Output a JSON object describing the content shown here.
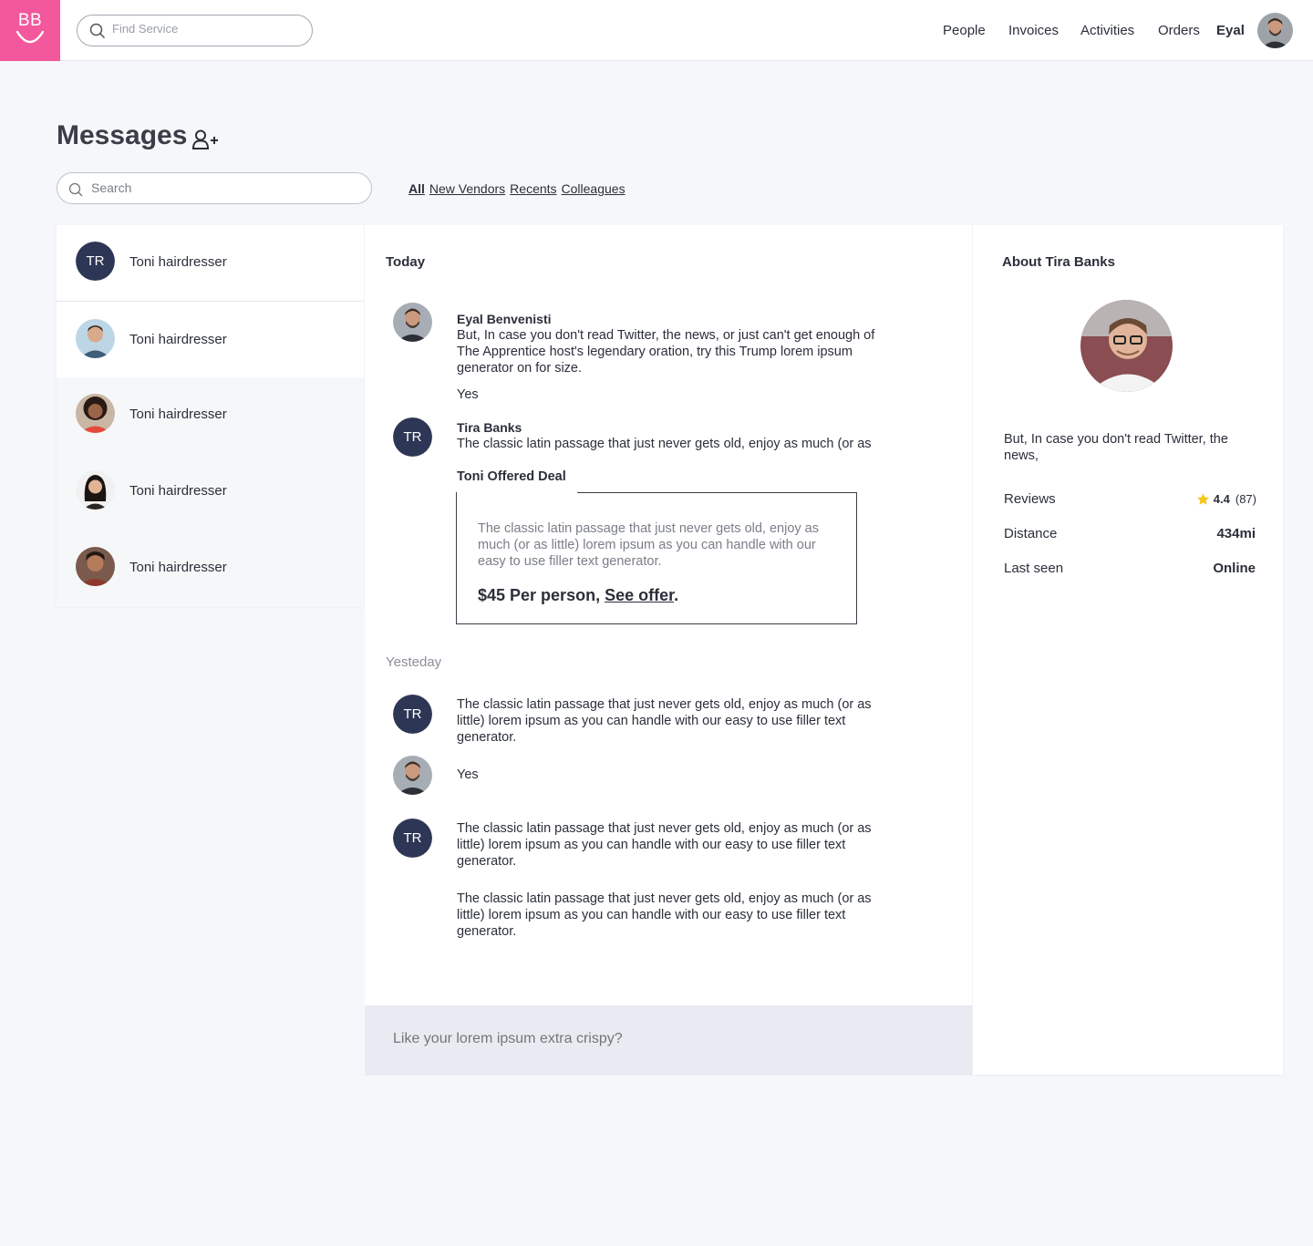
{
  "header": {
    "logo_text": "BB",
    "find_placeholder": "Find Service",
    "nav": [
      "People",
      "Invoices",
      "Activities",
      "Orders"
    ],
    "user_name": "Eyal"
  },
  "page": {
    "title": "Messages",
    "search_placeholder": "Search",
    "filters": [
      "All",
      "New Vendors",
      "Recents",
      "Colleagues"
    ]
  },
  "contacts": [
    {
      "name": "Toni hairdresser",
      "initials": "TR"
    },
    {
      "name": "Toni hairdresser"
    },
    {
      "name": "Toni hairdresser"
    },
    {
      "name": "Toni hairdresser"
    },
    {
      "name": "Toni hairdresser"
    }
  ],
  "conversation": {
    "today_label": "Today",
    "yesterday_label": "Yesteday",
    "messages": [
      {
        "sender": "Eyal Benvenisti",
        "text": "But, In case you don't read Twitter, the news, or just can't get enough of The Apprentice host's legendary oration, try this Trump lorem ipsum generator on for size."
      },
      {
        "text": "Yes"
      },
      {
        "sender": "Tira Banks",
        "initials": "TR",
        "text": "The classic latin passage that just never gets old, enjoy as much (or as"
      },
      {
        "initials": "TR",
        "text": "The classic latin passage that just never gets old, enjoy as much (or as little) lorem ipsum as you can handle with our easy to use filler text generator."
      },
      {
        "text": "Yes"
      },
      {
        "initials": "TR",
        "text": "The classic latin passage that just never gets old, enjoy as much (or as little) lorem ipsum as you can handle with our easy to use filler text generator."
      },
      {
        "text": "The classic latin passage that just never gets old, enjoy as much (or as little) lorem ipsum as you can handle with our easy to use filler text generator."
      }
    ],
    "deal": {
      "title": "Toni Offered Deal",
      "text": "The classic latin passage that just never gets old, enjoy as much (or as little) lorem ipsum as you can handle with our easy to use filler text generator.",
      "price": "$45 Per person,",
      "link": "See offer",
      "period": "."
    },
    "composer_placeholder": "Like your lorem ipsum extra crispy?"
  },
  "about": {
    "title": "About Tira Banks",
    "bio": "But, In case you don't read Twitter, the news,",
    "reviews_label": "Reviews",
    "rating": "4.4",
    "review_count": "(87)",
    "distance_label": "Distance",
    "distance": "434mi",
    "last_seen_label": "Last seen",
    "last_seen": "Online"
  },
  "colors": {
    "brand": "#f2589b",
    "avatar_navy": "#2d3654",
    "star": "#f5c518"
  }
}
